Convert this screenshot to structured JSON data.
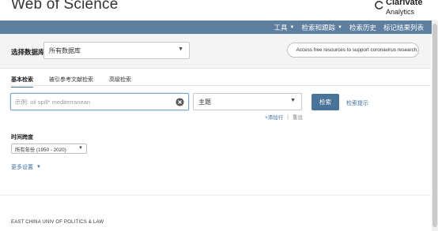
{
  "header": {
    "brand": "Web of Science",
    "publisher_line1": "Clarivate",
    "publisher_line2": "Analytics",
    "accent_color": "#5f7fa0"
  },
  "topnav": {
    "items": [
      {
        "label": "工具",
        "has_caret": true
      },
      {
        "label": "检索和跟踪",
        "has_caret": true
      },
      {
        "label": "检索历史",
        "has_caret": false
      },
      {
        "label": "标记结果列表",
        "has_caret": false
      }
    ]
  },
  "database": {
    "label": "选择数据库",
    "selected": "所有数据库"
  },
  "covid_notice": {
    "text": "Access free resources to support coronavirus research.",
    "icon": "bell-icon"
  },
  "tabs": [
    {
      "label": "基本检索",
      "active": true
    },
    {
      "label": "被引参考文献检索",
      "active": false
    },
    {
      "label": "高级检索",
      "active": false
    }
  ],
  "search": {
    "placeholder": "示例: oil spill* mediterranean",
    "value": "",
    "field_selected": "主题",
    "button_label": "检索",
    "tips_label": "检索提示",
    "add_row_label": "+添加行",
    "reset_label": "重设"
  },
  "timespan": {
    "label": "时间跨度",
    "selected": "所有年份 (1950 - 2020)"
  },
  "more_settings": {
    "label": "更多设置"
  },
  "footer": {
    "organization": "EAST CHINA UNIV OF POLITICS & LAW"
  }
}
